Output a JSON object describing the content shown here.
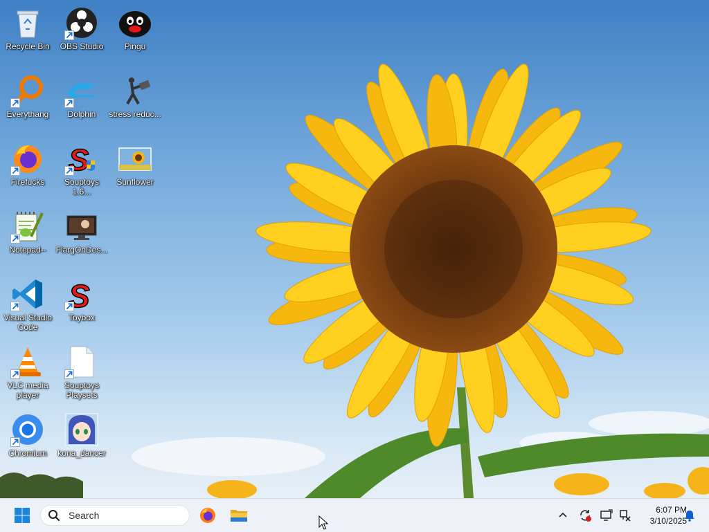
{
  "desktop": {
    "icons": [
      {
        "label": "Recycle Bin",
        "icon": "recycle-bin-icon"
      },
      {
        "label": "OBS Studio",
        "icon": "obs-icon"
      },
      {
        "label": "Pingu",
        "icon": "pingu-icon"
      },
      {
        "label": "Everythang",
        "icon": "everything-search-icon"
      },
      {
        "label": "Dolphin",
        "icon": "dolphin-icon"
      },
      {
        "label": "stress reduc...",
        "icon": "stress-reducer-icon"
      },
      {
        "label": "Firefucks",
        "icon": "firefox-icon"
      },
      {
        "label": "Souptoys 1.6...",
        "icon": "souptoys-icon"
      },
      {
        "label": "Sunflower",
        "icon": "sunflower-image-icon"
      },
      {
        "label": "Notepad--",
        "icon": "notepad-icon"
      },
      {
        "label": "FlargOnDes...",
        "icon": "flarg-icon"
      },
      {
        "label": "Visual Studio Code",
        "icon": "vscode-icon"
      },
      {
        "label": "Toybox",
        "icon": "toybox-icon"
      },
      {
        "label": "VLC media player",
        "icon": "vlc-icon"
      },
      {
        "label": "Souptoys Playsets",
        "icon": "document-icon"
      },
      {
        "label": "Chromium",
        "icon": "chromium-icon"
      },
      {
        "label": "kona_dancer",
        "icon": "kona-dancer-icon"
      }
    ]
  },
  "taskbar": {
    "search_placeholder": "Search",
    "pinned": [
      "start-icon",
      "firefox-icon",
      "file-explorer-icon"
    ],
    "tray": [
      "chevron-up-icon",
      "update-icon",
      "display-icon",
      "network-icon",
      "notification-icon"
    ],
    "time": "6:07 PM",
    "date": "3/10/2025"
  },
  "colors": {
    "sky": "#6fa6da",
    "taskbar": "#eef2f8",
    "accent": "#0067c0"
  }
}
